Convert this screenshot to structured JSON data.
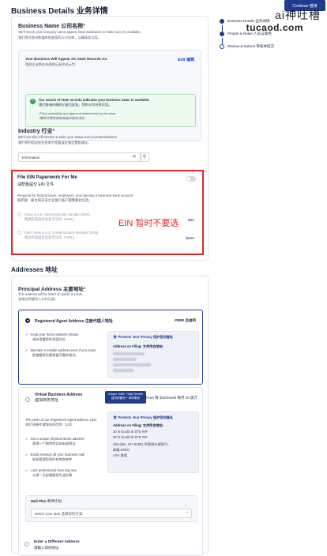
{
  "header": {
    "title": "Business Details 业务详情",
    "continue_btn": "Continue 继续"
  },
  "watermark": {
    "line1": "ai神吐槽",
    "line2": "tucaod.com"
  },
  "business_name": {
    "label": "Business Name 公司名称",
    "required_mark": "*",
    "help_en": "We'll check your company name against state databases to make sure it's available.",
    "help_zh": "我们将对照州数据库检查您的公司名称，以确保其可用。",
    "appear_label": "Your Business Will Appear On State Records As:",
    "appear_sub": "您的企业将在州政府记录中显示为:",
    "edit_label": "Edit 编辑",
    "success_en": "Our search of state records indicates your business name is available.",
    "success_zh": "我们查询州政府记录后发现，您的公司名称可用。",
    "success_note_en": "*Final availability and approval determined by the state.",
    "success_note_zh": "*最终可用性和批准由州政府决定。"
  },
  "industry": {
    "label": "Industry 行业",
    "required_mark": "*",
    "help_en": "We'll use this information to tailor your setup and recommendations.",
    "help_zh": "我们将利用这些信息来为您量身定制设置和建议。",
    "value": "Information",
    "clear_icon": "✕",
    "search_icon": "⚲"
  },
  "ein": {
    "title": "File EIN Paperwork For Me",
    "title_zh": "请帮我提交 EIN 文件",
    "req_en": "Required for federal taxes, employers, and opening a business bank account.",
    "req_zh": "联邦税、雇主和开设企业银行账户都需要此信息。",
    "option1_en": "I have a U.S. Social Security Number (SSN)",
    "option1_zh": "我拥有美国社会安全号码（SSN)。",
    "option1_price": "$50",
    "option2_en": "I don't have a U.S. Social Security Number (SSN)",
    "option2_zh": "我没有美国社会安全号码（SSN)。",
    "option2_price": "$200",
    "annotation": "EIN 暂时不要选"
  },
  "addresses": {
    "section_title": "Addresses 地址",
    "principal_label": "Principal Address 主要地址",
    "required_mark": "*",
    "principal_help_en": "This address will be listed on public records.",
    "principal_help_zh": "该地址将被列入公共记录。",
    "registered_agent": {
      "name": "Registered Agent Address 注册代理人地址",
      "price": "FREE 自由的",
      "bullet1_en": "Keep your home address private",
      "bullet1_zh": "请勿泄露您的家庭住址",
      "bullet2_en": "Maintain a reliable address even if you move",
      "bullet2_zh": "即使搬家也要保留可靠的地址。",
      "privacy_title": "Protects Your Privacy 保护您的隐私",
      "filing_label": "Address on Filing: 文件所在地址:"
    },
    "virtual_business": {
      "name_en": "Virtual Business Address",
      "name_zh": "虚拟商务地址",
      "badge_en": "Unique Suite + Mail Service",
      "badge_zh": "独特的套房 + 邮件服务",
      "price": "From 每 $20/month 每月 20 美元",
      "perks_en": "The perks of our Registered Agent address, plus:",
      "perks_zh": "我们注册代理地址的优势，以及：",
      "bullet1_en": "Get a unique physical street address",
      "bullet1_zh": "获得一个独特的实体街道地址",
      "bullet2_en": "Easily manage all your business mail",
      "bullet2_zh": "轻松管理您的所有商务邮件",
      "bullet3_en": "Look professional from day one",
      "bullet3_zh": "从第一天起就展现专业形象",
      "privacy_title": "Protects Your Privacy 保护您的隐私",
      "filing_label": "Address on Filing: 文件所在地址:",
      "addr1": "30 N Gould St  STE ###",
      "addr2": "30 N Gould St  STE ###",
      "addr3": "Sheridan, WY 82801  怀俄明州谢里丹，",
      "addr4": "邮编 82801",
      "addr5": "USA  美国"
    },
    "mail_plan": {
      "label": "Mail Plan",
      "label_zh": "邮件计划",
      "placeholder": "Select your plan  选择您的方案"
    },
    "different": {
      "name_en": "Enter a Different Address",
      "name_zh": "请输入其他地址"
    }
  },
  "steps": [
    {
      "label": "Business Details 业务详情"
    },
    {
      "label": "People & Roles 人员与角色"
    },
    {
      "label": "Review & Submit 审核并提交"
    }
  ]
}
